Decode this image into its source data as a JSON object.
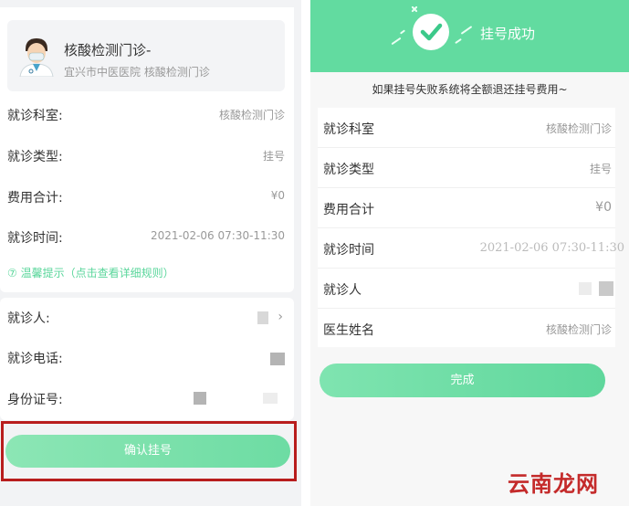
{
  "left": {
    "doctor": {
      "name": "核酸检测门诊-",
      "hospital": "宜兴市中医医院 核酸检测门诊"
    },
    "rows": [
      {
        "label": "就诊科室:",
        "value": "核酸检测门诊"
      },
      {
        "label": "就诊类型:",
        "value": "挂号"
      },
      {
        "label": "费用合计:",
        "value": "¥0"
      },
      {
        "label": "就诊时间:",
        "value": "2021-02-06 07:30-11:30"
      }
    ],
    "tip": "⑦ 温馨提示（点击查看详细规则）",
    "patient_rows": [
      {
        "label": "就诊人:"
      },
      {
        "label": "就诊电话:"
      },
      {
        "label": "身份证号:"
      }
    ],
    "confirm_button": "确认挂号"
  },
  "right": {
    "success_title": "挂号成功",
    "refund_notice": "如果挂号失败系统将全额退还挂号费用~",
    "rows": [
      {
        "label": "就诊科室",
        "value": "核酸检测门诊"
      },
      {
        "label": "就诊类型",
        "value": "挂号"
      },
      {
        "label": "费用合计",
        "value": "¥0"
      },
      {
        "label": "就诊时间",
        "value": "2021-02-06 07:30-11:30"
      },
      {
        "label": "就诊人",
        "value": ""
      },
      {
        "label": "医生姓名",
        "value": "核酸检测门诊"
      }
    ],
    "done_button": "完成"
  },
  "watermark": "云南龙网",
  "colors": {
    "accent": "#62dba0",
    "highlight": "#b81d1d"
  }
}
